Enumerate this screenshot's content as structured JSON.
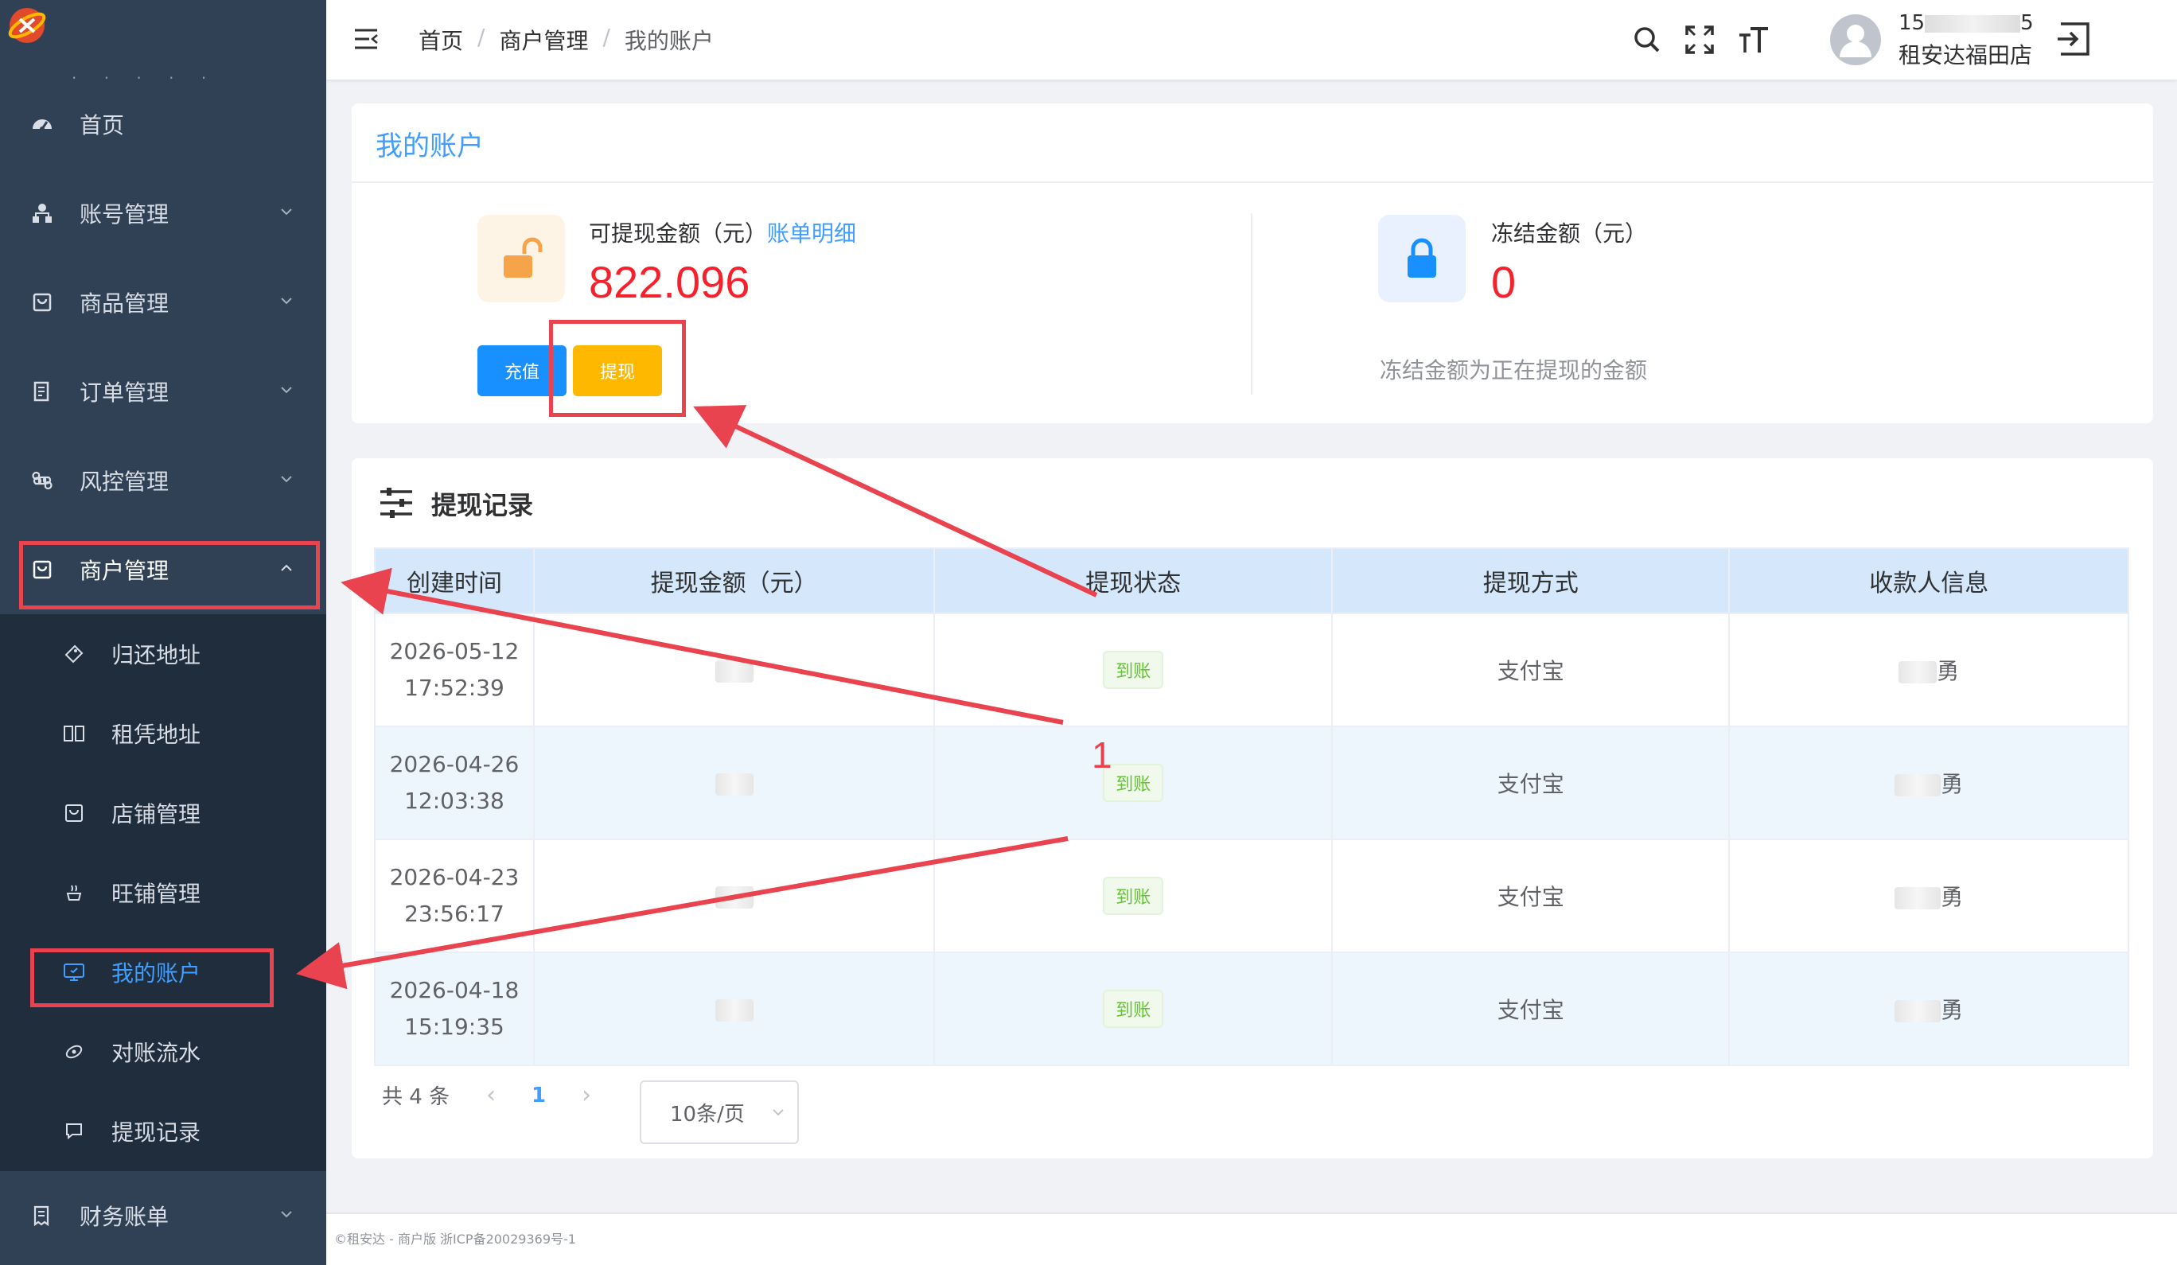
{
  "sidebar": {
    "items": [
      {
        "label": "首页",
        "icon": "dashboard-icon"
      },
      {
        "label": "账号管理",
        "icon": "account-tree-icon"
      },
      {
        "label": "商品管理",
        "icon": "shopping-bag-icon"
      },
      {
        "label": "订单管理",
        "icon": "order-list-icon"
      },
      {
        "label": "风控管理",
        "icon": "command-icon"
      },
      {
        "label": "商户管理",
        "icon": "merchant-icon"
      },
      {
        "label": "财务账单",
        "icon": "bill-icon"
      }
    ],
    "sub_items": [
      {
        "label": "归还地址",
        "icon": "tag-icon"
      },
      {
        "label": "租凭地址",
        "icon": "book-icon"
      },
      {
        "label": "店铺管理",
        "icon": "shop-icon"
      },
      {
        "label": "旺铺管理",
        "icon": "cup-icon"
      },
      {
        "label": "我的账户",
        "icon": "monitor-icon"
      },
      {
        "label": "对账流水",
        "icon": "eye-icon"
      },
      {
        "label": "提现记录",
        "icon": "chat-icon"
      }
    ]
  },
  "header": {
    "breadcrumb": [
      "首页",
      "商户管理",
      "我的账户"
    ],
    "user_phone_prefix": "15",
    "user_phone_suffix": "5",
    "user_shop": "租安达福田店"
  },
  "account": {
    "title": "我的账户",
    "withdrawable_label": "可提现金额（元）",
    "bill_detail_link": "账单明细",
    "withdrawable_amount": "822.096",
    "recharge_button": "充值",
    "withdraw_button": "提现",
    "frozen_label": "冻结金额（元）",
    "frozen_amount": "0",
    "frozen_note": "冻结金额为正在提现的金额"
  },
  "records": {
    "title": "提现记录",
    "columns": [
      "创建时间",
      "提现金额（元）",
      "提现状态",
      "提现方式",
      "收款人信息"
    ],
    "rows": [
      {
        "date": "2026-05-12",
        "time": "17:52:39",
        "status": "到账",
        "method": "支付宝",
        "payee_suffix": "勇"
      },
      {
        "date": "2026-04-26",
        "time": "12:03:38",
        "status": "到账",
        "method": "支付宝",
        "payee_suffix": "勇"
      },
      {
        "date": "2026-04-23",
        "time": "23:56:17",
        "status": "到账",
        "method": "支付宝",
        "payee_suffix": "勇"
      },
      {
        "date": "2026-04-18",
        "time": "15:19:35",
        "status": "到账",
        "method": "支付宝",
        "payee_suffix": "勇"
      }
    ],
    "total_text": "共 4 条",
    "current_page": "1",
    "page_size": "10条/页"
  },
  "footer": {
    "text": "©租安达 - 商户版 浙ICP备20029369号-1"
  },
  "annotation": {
    "number": "1"
  },
  "colors": {
    "sidebar_bg": "#304156",
    "submenu_bg": "#1f2d3d",
    "primary": "#409eff",
    "amount_red": "#f5222d",
    "withdraw_yellow": "#ffb800",
    "success_green": "#67c23a",
    "annotation_red": "#e8434f"
  }
}
